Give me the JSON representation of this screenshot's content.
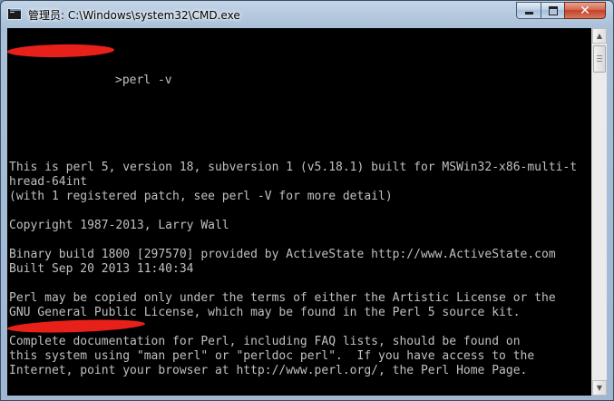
{
  "window": {
    "title": "管理员: C:\\Windows\\system32\\CMD.exe",
    "icon": "cmd-icon",
    "controls": {
      "minimize": "minimize-icon",
      "maximize": "maximize-icon",
      "close_label": "✕"
    }
  },
  "console": {
    "prompt_command": ">perl -v",
    "lines": [
      "This is perl 5, version 18, subversion 1 (v5.18.1) built for MSWin32-x86-multi-t",
      "hread-64int",
      "(with 1 registered patch, see perl -V for more detail)",
      "",
      "Copyright 1987-2013, Larry Wall",
      "",
      "Binary build 1800 [297570] provided by ActiveState http://www.ActiveState.com",
      "Built Sep 20 2013 11:40:34",
      "",
      "Perl may be copied only under the terms of either the Artistic License or the",
      "GNU General Public License, which may be found in the Perl 5 source kit.",
      "",
      "Complete documentation for Perl, including FAQ lists, should be found on",
      "this system using \"man perl\" or \"perldoc perl\".  If you have access to the",
      "Internet, point your browser at http://www.perl.org/, the Perl Home Page."
    ]
  },
  "scrollbar": {
    "up_glyph": "▲",
    "down_glyph": "▼"
  },
  "colors": {
    "console_bg": "#000000",
    "console_text": "#c0c0c0",
    "redaction": "#e8201a"
  }
}
